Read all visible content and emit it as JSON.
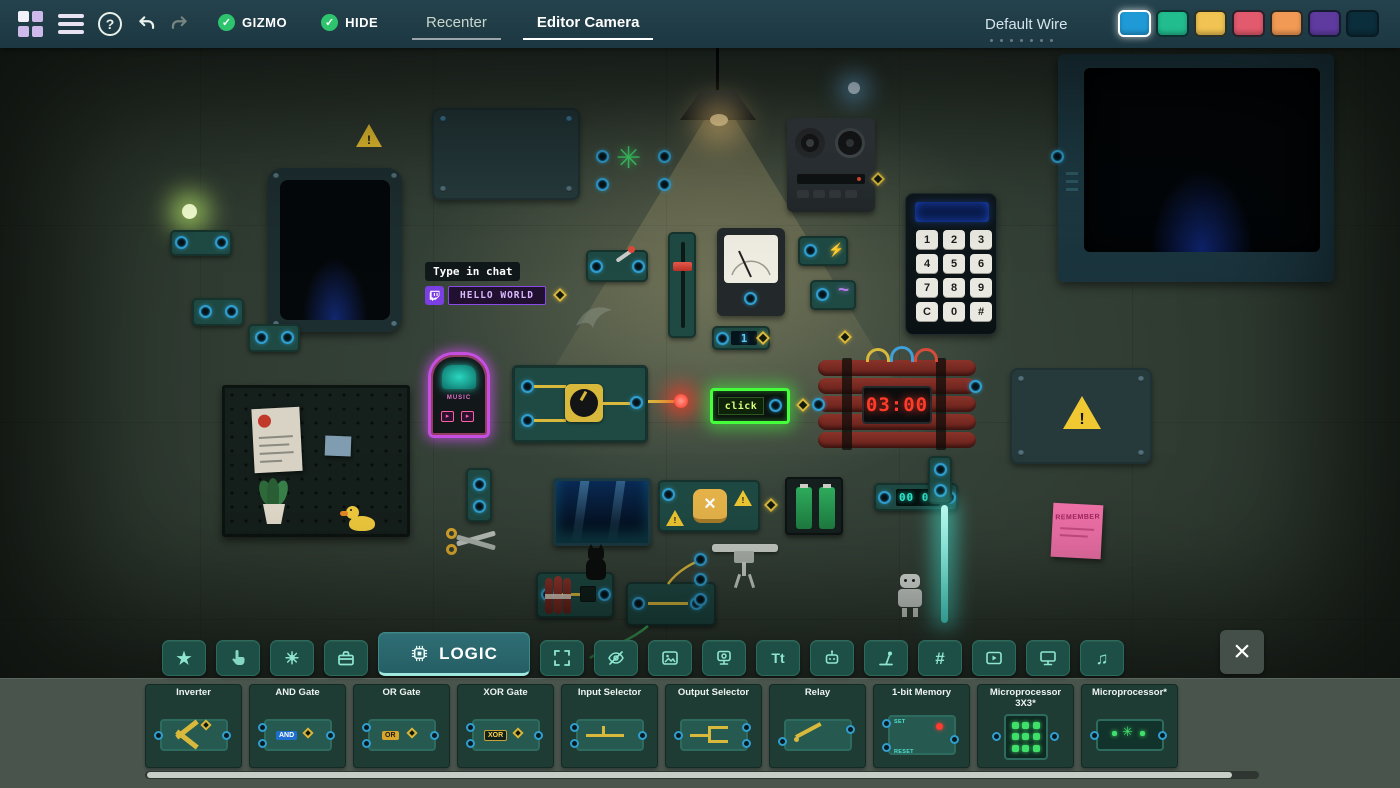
{
  "topbar": {
    "help_label": "?",
    "gizmo_label": "GIZMO",
    "hide_label": "HIDE",
    "recenter_label": "Recenter",
    "editor_camera_label": "Editor Camera",
    "default_wire_label": "Default Wire",
    "wire_colors": [
      {
        "name": "blue",
        "hex": "#1f9ad6",
        "selected": true
      },
      {
        "name": "green",
        "hex": "#21bd8f",
        "selected": false
      },
      {
        "name": "yellow",
        "hex": "#f0c352",
        "selected": false
      },
      {
        "name": "red",
        "hex": "#e25a6d",
        "selected": false
      },
      {
        "name": "orange",
        "hex": "#f19a55",
        "selected": false
      },
      {
        "name": "purple",
        "hex": "#5f3ba0",
        "selected": false
      },
      {
        "name": "navy",
        "hex": "#0b2e3c",
        "selected": false
      }
    ]
  },
  "icons": {
    "star": "★",
    "sun": "☀",
    "hash": "#",
    "text": "Tt",
    "music": "♫",
    "gear": "✳",
    "bolt": "⚡",
    "wave": "~",
    "check": "✓",
    "close": "×",
    "exclaim": "!"
  },
  "scene": {
    "chat": {
      "label": "Type in chat",
      "value": "HELLO WORLD"
    },
    "click_button_label": "click",
    "bomb_timer": "03:00",
    "jukebox_label": "MUSIC",
    "sticky_note": "REMEMBER",
    "counter_value": "00 00",
    "lever_display": "1",
    "keypad_keys": [
      "1",
      "2",
      "3",
      "4",
      "5",
      "6",
      "7",
      "8",
      "9",
      "C",
      "0",
      "#"
    ]
  },
  "toolbar": {
    "logic_label": "LOGIC"
  },
  "palette": {
    "items": [
      {
        "title": "Inverter"
      },
      {
        "title": "AND Gate",
        "tag": "AND"
      },
      {
        "title": "OR Gate",
        "tag": "OR"
      },
      {
        "title": "XOR Gate",
        "tag": "XOR"
      },
      {
        "title": "Input Selector"
      },
      {
        "title": "Output Selector"
      },
      {
        "title": "Relay"
      },
      {
        "title": "1-bit Memory",
        "set_label": "SET",
        "reset_label": "RESET"
      },
      {
        "title": "Microprocessor 3X3*"
      },
      {
        "title": "Microprocessor*"
      }
    ]
  }
}
